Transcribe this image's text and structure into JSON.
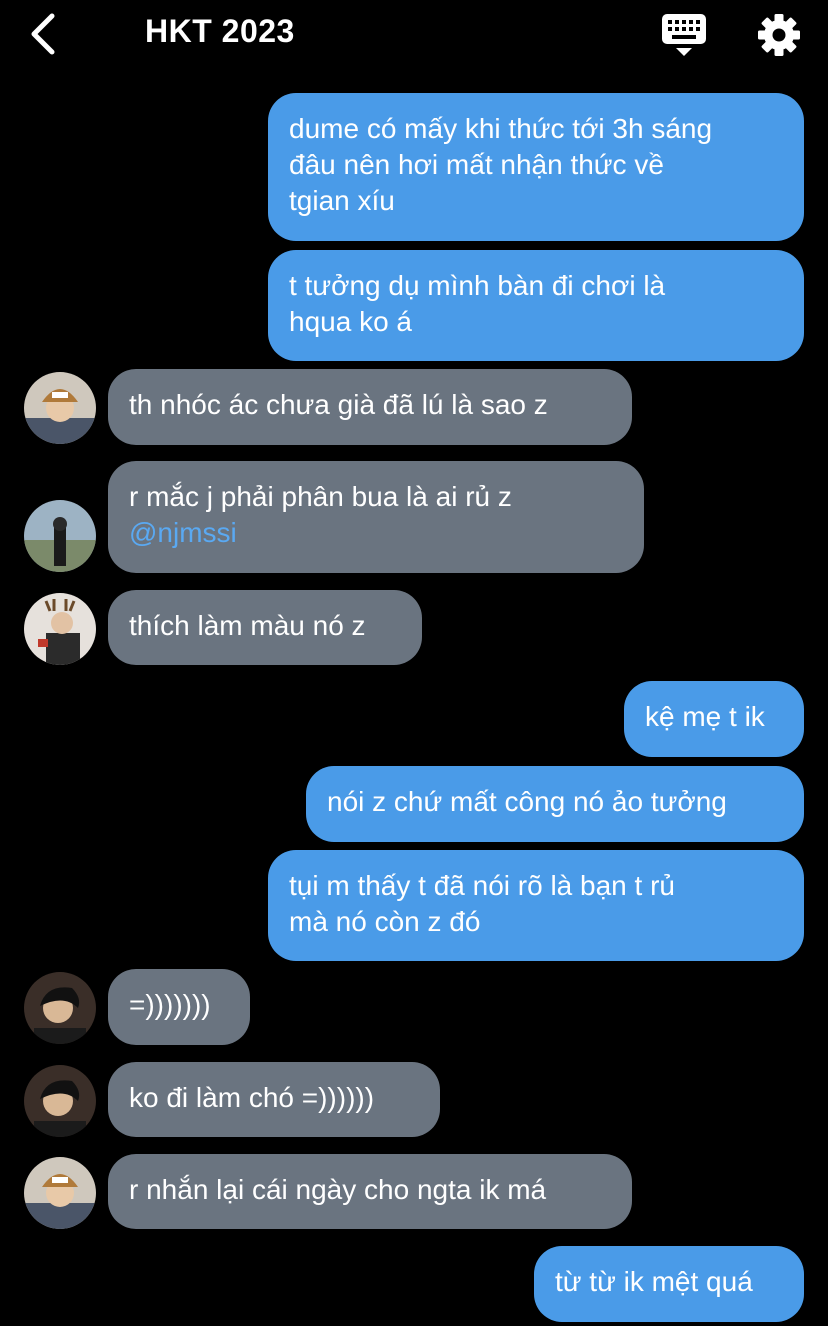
{
  "header": {
    "title": "HKT 2023",
    "back_icon": "chevron-left-icon",
    "keyboard_icon": "keyboard-icon",
    "settings_icon": "gear-icon"
  },
  "colors": {
    "outgoing_bubble": "#4A9BE8",
    "incoming_bubble": "#6A7480",
    "mention": "#5AA9F2",
    "background": "#000000"
  },
  "messages": [
    {
      "side": "out",
      "lines": [
        "dume có mấy khi thức tới 3h sáng",
        "đâu nên hơi mất nhận thức về",
        "tgian xíu"
      ]
    },
    {
      "side": "out",
      "lines": [
        "t tưởng dụ mình bàn đi chơi là",
        "hqua ko á"
      ]
    },
    {
      "side": "in",
      "avatar": "avatar-beanie",
      "lines": [
        "th nhóc ác chưa già đã lú là sao z"
      ]
    },
    {
      "side": "in",
      "avatar": "avatar-outdoor",
      "lines": [
        "r mắc j phải phân bua là ai rủ z"
      ],
      "mention": "@njmssi"
    },
    {
      "side": "in",
      "avatar": "avatar-antlers",
      "lines": [
        "thích làm màu nó z"
      ]
    },
    {
      "side": "out",
      "lines": [
        "kệ mẹ t ik"
      ]
    },
    {
      "side": "out",
      "lines": [
        "nói z chứ mất công nó ảo tưởng"
      ]
    },
    {
      "side": "out",
      "lines": [
        "tụi m thấy t đã nói rõ là bạn t rủ",
        "mà nó còn z đó"
      ]
    },
    {
      "side": "in",
      "avatar": "avatar-dark",
      "lines": [
        "=)))))))"
      ]
    },
    {
      "side": "in",
      "avatar": "avatar-dark",
      "lines": [
        "ko đi làm chó =))))))"
      ]
    },
    {
      "side": "in",
      "avatar": "avatar-beanie",
      "lines": [
        "r nhắn lại cái ngày cho ngta ik má"
      ]
    },
    {
      "side": "out",
      "lines": [
        "từ từ ik mệt quá"
      ]
    }
  ]
}
